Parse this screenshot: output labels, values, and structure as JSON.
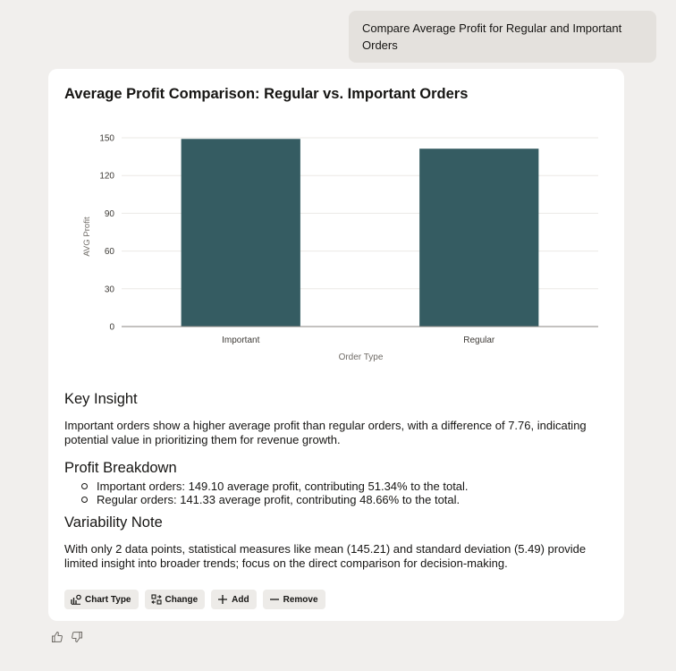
{
  "user_message": "Compare Average Profit for Regular and Important Orders",
  "response": {
    "title": "Average Profit Comparison: Regular vs. Important Orders",
    "sections": {
      "key_insight": {
        "heading": "Key Insight",
        "text": "Important orders show a higher average profit than regular orders, with a difference of 7.76, indicating potential value in prioritizing them for revenue growth."
      },
      "profit_breakdown": {
        "heading": "Profit Breakdown",
        "bullets": [
          "Important orders: 149.10 average profit, contributing 51.34% to the total.",
          "Regular orders: 141.33 average profit, contributing 48.66% to the total."
        ]
      },
      "variability": {
        "heading": "Variability Note",
        "text": "With only 2 data points, statistical measures like mean (145.21) and standard deviation (5.49) provide limited insight into broader trends; focus on the direct comparison for decision-making."
      }
    },
    "actions": {
      "chart_type": "Chart Type",
      "change": "Change",
      "add": "Add",
      "remove": "Remove"
    }
  },
  "colors": {
    "bar": "#355c62",
    "card": "#ffffff",
    "background": "#f1efed",
    "bubble": "#e4e1dd"
  },
  "icons": [
    "chart-type-icon",
    "change-icon",
    "plus-icon",
    "minus-icon",
    "thumbs-up-icon",
    "thumbs-down-icon"
  ],
  "chart_data": {
    "type": "bar",
    "categories": [
      "Important",
      "Regular"
    ],
    "values": [
      149.1,
      141.33
    ],
    "xlabel": "Order Type",
    "ylabel": "AVG Profit",
    "ylim": [
      0,
      150
    ],
    "yticks": [
      0,
      30,
      60,
      90,
      120,
      150
    ],
    "grid": true
  }
}
